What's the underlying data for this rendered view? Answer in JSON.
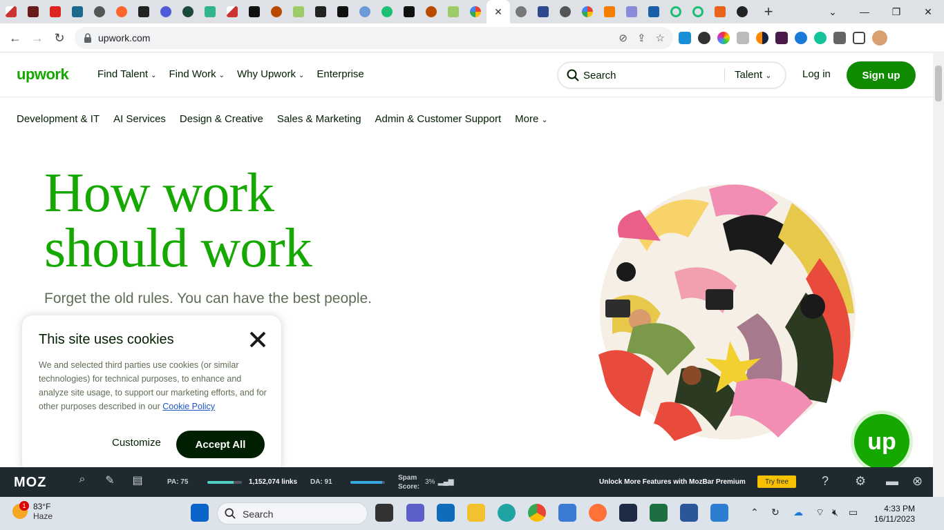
{
  "browser": {
    "url": "upwork.com",
    "tab_close": "✕",
    "new_tab": "+"
  },
  "header": {
    "logo": "upwork",
    "nav": [
      "Find Talent",
      "Find Work",
      "Why Upwork",
      "Enterprise"
    ],
    "search_placeholder": "Search",
    "search_scope": "Talent",
    "login": "Log in",
    "signup": "Sign up"
  },
  "categories": [
    "Development & IT",
    "AI Services",
    "Design & Creative",
    "Sales & Marketing",
    "Admin & Customer Support",
    "More"
  ],
  "hero": {
    "title_line1": "How work",
    "title_line2": "should work",
    "subtitle": "Forget the old rules. You can have the best people."
  },
  "cookie": {
    "title": "This site uses cookies",
    "body": "We and selected third parties use cookies (or similar technologies) for technical purposes, to enhance and analyze site usage, to support our marketing efforts, and for other purposes described in our ",
    "link": "Cookie Policy",
    "customize": "Customize",
    "accept": "Accept All"
  },
  "badge": {
    "text": "up"
  },
  "mozbar": {
    "logo": "MOZ",
    "pa": "PA: 75",
    "links": "1,152,074 links",
    "da": "DA: 91",
    "spam_label_1": "Spam",
    "spam_label_2": "Score:",
    "spam": "3%",
    "cta": "Unlock More Features with MozBar Premium",
    "try": "Try free"
  },
  "taskbar": {
    "temp": "83°F",
    "condition": "Haze",
    "badge_count": "1",
    "search": "Search",
    "time": "4:33 PM",
    "date": "16/11/2023"
  },
  "colors": {
    "brand": "#14a800",
    "brand_dark": "#108a00",
    "ink": "#001e00"
  }
}
